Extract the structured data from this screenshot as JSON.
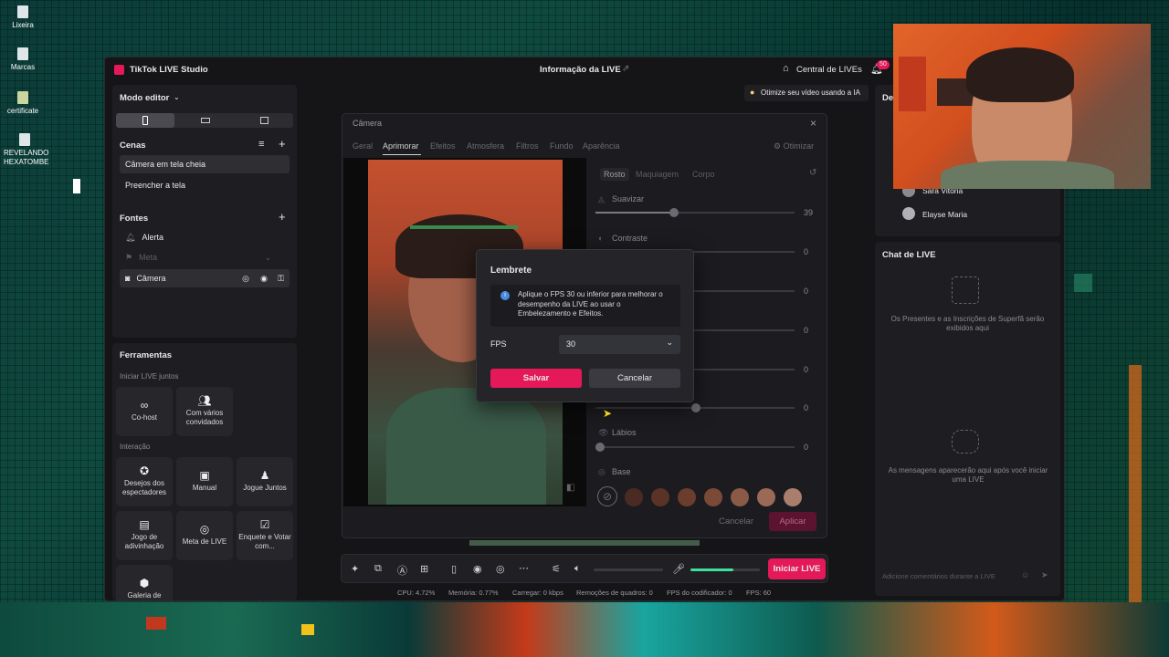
{
  "desktop": {
    "icons": [
      "Lixeira",
      "Marcas",
      "certificate",
      "REVELANDO HEXATOMBE"
    ]
  },
  "app": {
    "title": "TikTok LIVE Studio",
    "center_title": "Informação da LIVE",
    "live_center": "Central de LIVEs",
    "notif_count": "50",
    "optimize_banner": "Otimize seu vídeo usando a IA"
  },
  "left": {
    "mode": "Modo editor",
    "scenes_title": "Cenas",
    "scenes": [
      "Câmera em tela cheia",
      "Preencher a tela"
    ],
    "sources_title": "Fontes",
    "sources": [
      "Alerta",
      "Meta",
      "Câmera"
    ],
    "tools_title": "Ferramentas",
    "live_together": "Iniciar LIVE juntos",
    "cohost": "Co-host",
    "multi_guests": "Com vários convidados",
    "interaction": "Interação",
    "tools": [
      "Desejos dos espectadores",
      "Manual",
      "Jogue Juntos",
      "Jogo de adivinhação",
      "Meta de LIVE",
      "Enquete e Votar com...",
      "Galeria de"
    ]
  },
  "camera_dialog": {
    "title": "Câmera",
    "tabs": [
      "Geral",
      "Aprimorar",
      "Efeitos",
      "Atmosfera",
      "Filtros",
      "Fundo",
      "Aparência"
    ],
    "optimize": "Otimizar",
    "subtabs": [
      "Rosto",
      "Maquiagem",
      "Corpo"
    ],
    "smooth": "Suavizar",
    "smooth_val": "39",
    "contrast": "Contraste",
    "zeros": [
      "0",
      "0",
      "0",
      "0",
      "0",
      "0"
    ],
    "lips": "Lábios",
    "lips_val": "0",
    "base": "Base",
    "cancel": "Cancelar",
    "apply": "Aplicar",
    "swatch_colors": [
      "#4a2a22",
      "#5a3326",
      "#6a3d2c",
      "#7a4a36",
      "#8a5a46",
      "#9a6a56",
      "#aa7e6c"
    ]
  },
  "reminder": {
    "title": "Lembrete",
    "message": "Aplique o FPS 30 ou inferior para melhorar o desempenho da LIVE ao usar o Embelezamento e Efeitos.",
    "fps_label": "FPS",
    "fps_value": "30",
    "save": "Salvar",
    "cancel": "Cancelar"
  },
  "toolbar": {
    "start_live": "Iniciar LIVE",
    "mic_level": 0.62
  },
  "status": {
    "cpu": "CPU: 4.72%",
    "memory": "Memória: 0.77%",
    "upload": "Carregar: 0 kbps",
    "dropped": "Remoções de quadros: 0",
    "encoder_fps": "FPS do codificador: 0",
    "fps": "FPS: 60"
  },
  "right": {
    "header": "De",
    "viewers": [
      "Sara Vitória",
      "Elayse Maria"
    ],
    "chat_title": "Chat de LIVE",
    "gifts_text": "Os Presentes e as Inscrições de Superfã serão exibidos aqui",
    "messages_text": "As mensagens aparecerão aqui após você iniciar uma LIVE",
    "comment_placeholder": "Adicione comentários durante a LIVE"
  },
  "colors": {
    "accent": "#e5195a",
    "bg": "#151518",
    "panel": "#1e1e22"
  }
}
